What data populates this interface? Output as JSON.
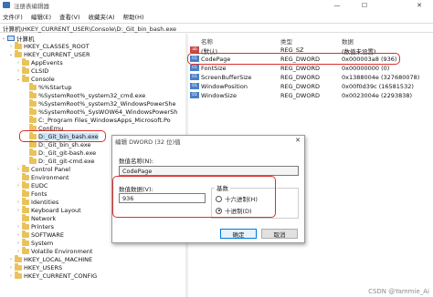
{
  "window": {
    "title": "注册表编辑器",
    "controls": {
      "minimize": "—",
      "maximize": "☐",
      "close": "✕"
    }
  },
  "menu": [
    "文件(F)",
    "编辑(E)",
    "查看(V)",
    "收藏夹(A)",
    "帮助(H)"
  ],
  "address": "计算机\\HKEY_CURRENT_USER\\Console\\D:_Git_bin_bash.exe",
  "tree": [
    {
      "label": "计算机",
      "toggle": "⌄",
      "icon": "computer-icon"
    },
    {
      "label": "HKEY_CLASSES_ROOT",
      "toggle": "›",
      "icon": "folder-icon"
    },
    {
      "label": "HKEY_CURRENT_USER",
      "toggle": "⌄",
      "icon": "folder-icon"
    },
    {
      "label": "AppEvents",
      "toggle": "›",
      "icon": "folder-icon"
    },
    {
      "label": "CLSID",
      "toggle": "›",
      "icon": "folder-icon"
    },
    {
      "label": "Console",
      "toggle": "⌄",
      "icon": "folder-icon"
    },
    {
      "label": "%%Startup",
      "toggle": "",
      "icon": "folder-icon"
    },
    {
      "label": "%SystemRoot%_system32_cmd.exe",
      "toggle": "",
      "icon": "folder-icon"
    },
    {
      "label": "%SystemRoot%_system32_WindowsPowerShe",
      "toggle": "",
      "icon": "folder-icon"
    },
    {
      "label": "%SystemRoot%_SysWOW64_WindowsPowerSh",
      "toggle": "",
      "icon": "folder-icon"
    },
    {
      "label": "C:_Program Files_WindowsApps_Microsoft.Po",
      "toggle": "",
      "icon": "folder-icon"
    },
    {
      "label": "ConEmu",
      "toggle": "",
      "icon": "folder-icon"
    },
    {
      "label": "D:_Git_bin_bash.exe",
      "toggle": "",
      "icon": "folder-icon"
    },
    {
      "label": "D:_Git_bin_sh.exe",
      "toggle": "",
      "icon": "folder-icon"
    },
    {
      "label": "D:_Git_git-bash.exe",
      "toggle": "",
      "icon": "folder-icon"
    },
    {
      "label": "D:_Git_git-cmd.exe",
      "toggle": "",
      "icon": "folder-icon"
    },
    {
      "label": "Control Panel",
      "toggle": "›",
      "icon": "folder-icon"
    },
    {
      "label": "Environment",
      "toggle": "",
      "icon": "folder-icon"
    },
    {
      "label": "EUDC",
      "toggle": "›",
      "icon": "folder-icon"
    },
    {
      "label": "Fonts",
      "toggle": "",
      "icon": "folder-icon"
    },
    {
      "label": "Identities",
      "toggle": "›",
      "icon": "folder-icon"
    },
    {
      "label": "Keyboard Layout",
      "toggle": "›",
      "icon": "folder-icon"
    },
    {
      "label": "Network",
      "toggle": "",
      "icon": "folder-icon"
    },
    {
      "label": "Printers",
      "toggle": "›",
      "icon": "folder-icon"
    },
    {
      "label": "SOFTWARE",
      "toggle": "›",
      "icon": "folder-icon"
    },
    {
      "label": "System",
      "toggle": "›",
      "icon": "folder-icon"
    },
    {
      "label": "Volatile Environment",
      "toggle": "›",
      "icon": "folder-icon"
    },
    {
      "label": "HKEY_LOCAL_MACHINE",
      "toggle": "›",
      "icon": "folder-icon"
    },
    {
      "label": "HKEY_USERS",
      "toggle": "›",
      "icon": "folder-icon"
    },
    {
      "label": "HKEY_CURRENT_CONFIG",
      "toggle": "›",
      "icon": "folder-icon"
    }
  ],
  "list": {
    "headers": {
      "name": "名称",
      "type": "类型",
      "data": "数据"
    },
    "rows": [
      {
        "icon": "ab",
        "name": "(默认)",
        "type": "REG_SZ",
        "data": "(数值未设置)"
      },
      {
        "icon": "01",
        "name": "CodePage",
        "type": "REG_DWORD",
        "data": "0x000003a8 (936)"
      },
      {
        "icon": "01",
        "name": "FontSize",
        "type": "REG_DWORD",
        "data": "0x00000000 (0)"
      },
      {
        "icon": "01",
        "name": "ScreenBufferSize",
        "type": "REG_DWORD",
        "data": "0x1388004e (327680078)"
      },
      {
        "icon": "01",
        "name": "WindowPosition",
        "type": "REG_DWORD",
        "data": "0x00f0d39c (16581532)"
      },
      {
        "icon": "01",
        "name": "WindowSize",
        "type": "REG_DWORD",
        "data": "0x0023004e (2293838)"
      }
    ]
  },
  "dialog": {
    "title": "编辑 DWORD (32 位)值",
    "close": "✕",
    "name_label": "数值名称(N):",
    "name_value": "CodePage",
    "data_label": "数值数据(V):",
    "data_value": "936",
    "base_label": "基数",
    "radio_hex": "十六进制(H)",
    "radio_dec": "十进制(D)",
    "selected_base": "dec",
    "ok": "确定",
    "cancel": "取消"
  },
  "watermark": "CSDN @Yammie_Ai"
}
